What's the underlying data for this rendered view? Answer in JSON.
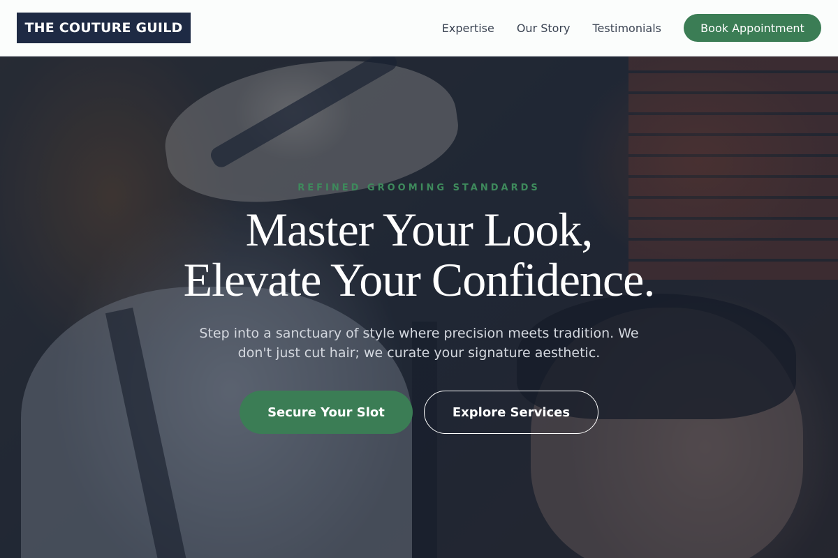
{
  "nav": {
    "logo": "THE COUTURE GUILD",
    "links": [
      "Expertise",
      "Our Story",
      "Testimonials"
    ],
    "cta": "Book Appointment"
  },
  "hero": {
    "eyebrow": "REFINED GROOMING STANDARDS",
    "headline_line1": "Master Your Look,",
    "headline_line2": "Elevate Your Confidence.",
    "subtext": "Step into a sanctuary of style where precision meets tradition. We don't just cut hair; we curate your signature aesthetic.",
    "primary_button": "Secure Your Slot",
    "secondary_button": "Explore Services"
  },
  "colors": {
    "brand_navy": "#1e2a44",
    "accent_green": "#3b7d55"
  }
}
